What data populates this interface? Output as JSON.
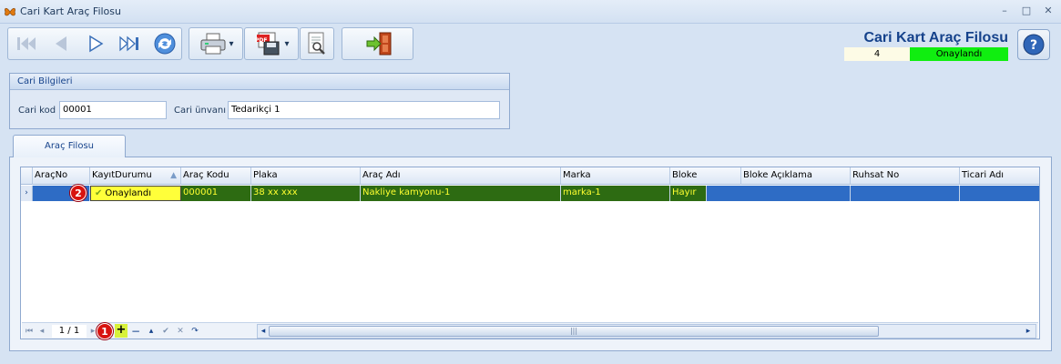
{
  "window": {
    "title": "Cari Kart Araç Filosu",
    "app_icon": "butterfly-icon",
    "controls": {
      "minimize": "–",
      "maximize": "□",
      "close": "✕"
    }
  },
  "toolbar": {
    "nav_icons": [
      "first-record-icon",
      "previous-record-icon",
      "next-record-icon",
      "last-record-icon",
      "refresh-icon"
    ],
    "print_icon": "printer-icon",
    "pdf_icon": "pdf-save-icon",
    "pdf_label": "PDF",
    "preview_icon": "page-search-icon",
    "exit_icon": "exit-door-icon",
    "dropdown_glyph": "▾"
  },
  "header": {
    "title": "Cari Kart Araç Filosu",
    "record_count": "4",
    "status": "Onaylandı",
    "help_icon": "help-icon",
    "help_glyph": "?"
  },
  "cari_bilgileri": {
    "title": "Cari Bilgileri",
    "kod_label": "Cari kod",
    "kod_value": "00001",
    "unvan_label": "Cari ünvanı",
    "unvan_value": "Tedarikçi 1"
  },
  "tabs": [
    {
      "label": "Araç Filosu"
    }
  ],
  "grid": {
    "columns": [
      "AraçNo",
      "KayıtDurumu",
      "Araç Kodu",
      "Plaka",
      "Araç Adı",
      "Marka",
      "Bloke",
      "Bloke Açıklama",
      "Ruhsat No",
      "Ticari Adı"
    ],
    "sort_indicator": "▲",
    "row_indicator": "›",
    "rows": [
      {
        "arac_no": "",
        "kayit_durumu": "Onaylandı",
        "status_icon": "check-icon",
        "status_glyph": "✔",
        "arac_kodu": "000001",
        "plaka": "38 xx xxx",
        "arac_adi": "Nakliye kamyonu-1",
        "marka": "marka-1",
        "bloke": "Hayır",
        "bloke_aciklama": "",
        "ruhsat_no": "",
        "ticari_adi": ""
      }
    ]
  },
  "annotations": {
    "badge_1": "1",
    "badge_2": "2"
  },
  "navigator": {
    "page_info": "1 / 1",
    "first": "⏮",
    "prev": "◂",
    "next": "▸",
    "add": "+",
    "remove": "−",
    "up": "▴",
    "confirm": "✔",
    "cancel": "✕",
    "refresh": "↷",
    "scroll_left": "◂",
    "scroll_right": "▸",
    "scroll_grip": "|||"
  },
  "colors": {
    "selected_row": "#2e6cc5",
    "highlight_cell": "#2d6b12",
    "highlight_text": "#ffff30",
    "status_green": "#10ee10",
    "badge_red": "#d8130f"
  }
}
